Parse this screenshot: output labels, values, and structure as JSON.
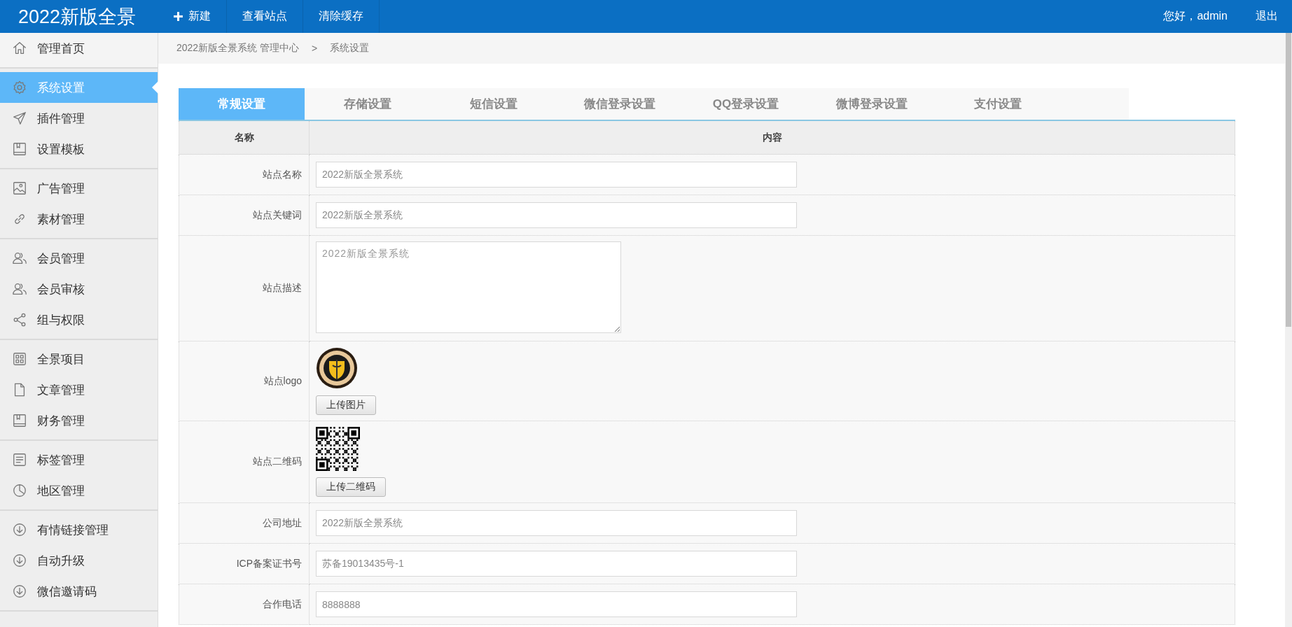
{
  "header": {
    "brand": "2022新版全景",
    "nav": [
      {
        "label": "新建",
        "kind": "create"
      },
      {
        "label": "查看站点",
        "kind": "link"
      },
      {
        "label": "清除缓存",
        "kind": "link"
      }
    ],
    "greeting": "您好，admin",
    "logout": "退出"
  },
  "sidebar": {
    "groups": [
      {
        "items": [
          {
            "label": "管理首页",
            "kind": "home",
            "selected": false
          }
        ]
      },
      {
        "items": [
          {
            "label": "系统设置",
            "kind": "gear",
            "selected": true
          },
          {
            "label": "插件管理",
            "kind": "send",
            "selected": false
          },
          {
            "label": "设置模板",
            "kind": "book",
            "selected": false
          }
        ]
      },
      {
        "items": [
          {
            "label": "广告管理",
            "kind": "picture",
            "selected": false
          },
          {
            "label": "素材管理",
            "kind": "link",
            "selected": false
          }
        ]
      },
      {
        "items": [
          {
            "label": "会员管理",
            "kind": "users",
            "selected": false
          },
          {
            "label": "会员审核",
            "kind": "users",
            "selected": false
          },
          {
            "label": "组与权限",
            "kind": "share",
            "selected": false
          }
        ]
      },
      {
        "items": [
          {
            "label": "全景项目",
            "kind": "grid",
            "selected": false
          },
          {
            "label": "文章管理",
            "kind": "file",
            "selected": false
          },
          {
            "label": "财务管理",
            "kind": "book",
            "selected": false
          }
        ]
      },
      {
        "items": [
          {
            "label": "标签管理",
            "kind": "list",
            "selected": false
          },
          {
            "label": "地区管理",
            "kind": "pie",
            "selected": false
          }
        ]
      },
      {
        "items": [
          {
            "label": "有情链接管理",
            "kind": "download",
            "selected": false
          },
          {
            "label": "自动升级",
            "kind": "download",
            "selected": false
          },
          {
            "label": "微信邀请码",
            "kind": "download",
            "selected": false
          }
        ]
      }
    ]
  },
  "breadcrumb": [
    "2022新版全景系统 管理中心",
    ">",
    "系统设置"
  ],
  "tabs": [
    {
      "label": "常规设置",
      "selected": true
    },
    {
      "label": "存储设置",
      "selected": false
    },
    {
      "label": "短信设置",
      "selected": false
    },
    {
      "label": "微信登录设置",
      "selected": false
    },
    {
      "label": "QQ登录设置",
      "selected": false
    },
    {
      "label": "微博登录设置",
      "selected": false
    },
    {
      "label": "支付设置",
      "selected": false
    }
  ],
  "table": {
    "columns": [
      "名称",
      "内容"
    ],
    "rows": [
      {
        "kind": "input",
        "label": "站点名称",
        "value": "2022新版全景系统"
      },
      {
        "kind": "input",
        "label": "站点关键词",
        "value": "2022新版全景系统"
      },
      {
        "kind": "textarea",
        "label": "站点描述",
        "value": "2022新版全景系统"
      },
      {
        "kind": "logo",
        "label": "站点logo",
        "button": "上传图片"
      },
      {
        "kind": "qrcode",
        "label": "站点二维码",
        "button": "上传二维码"
      },
      {
        "kind": "input",
        "label": "公司地址",
        "value": "2022新版全景系统"
      },
      {
        "kind": "input",
        "label": "ICP备案证书号",
        "value": "苏备19013435号-1"
      },
      {
        "kind": "input",
        "label": "合作电话",
        "value": "8888888"
      }
    ]
  }
}
